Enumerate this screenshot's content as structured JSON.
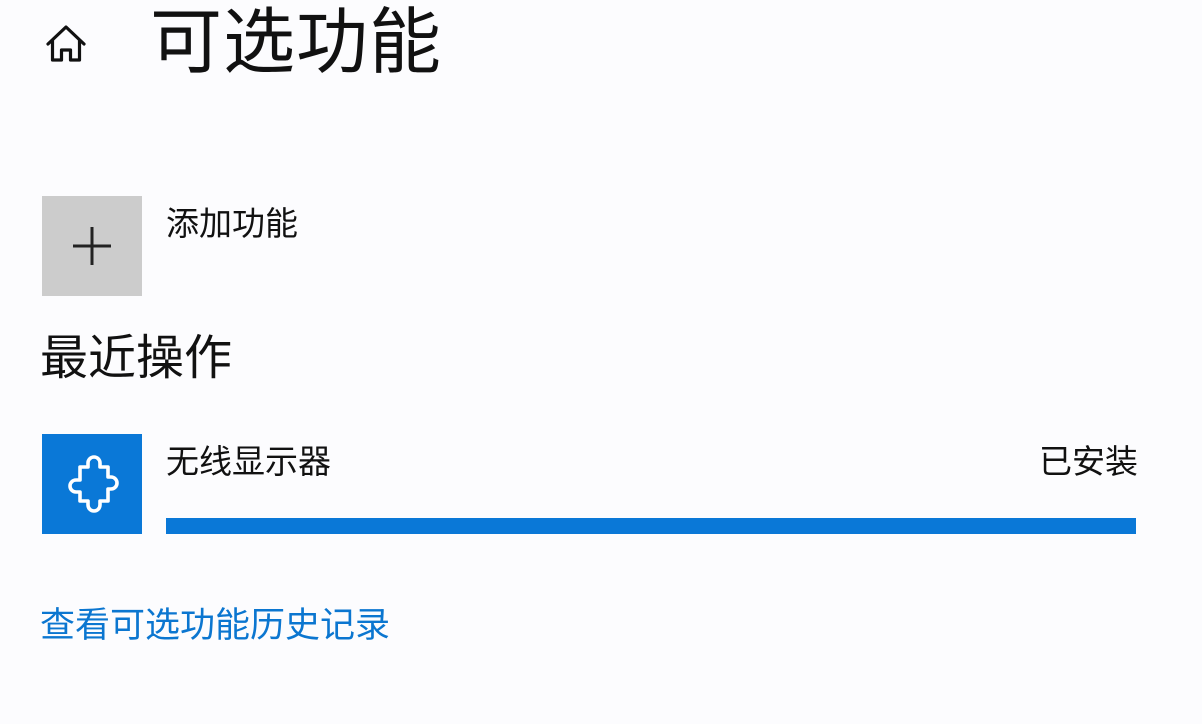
{
  "header": {
    "home_icon": "home-icon",
    "title": "可选功能"
  },
  "add_feature": {
    "icon": "plus-icon",
    "label": "添加功能"
  },
  "recent_actions": {
    "heading": "最近操作",
    "items": [
      {
        "icon": "puzzle-icon",
        "name": "无线显示器",
        "status": "已安装",
        "progress": 1.0
      }
    ]
  },
  "history_link": "查看可选功能历史记录",
  "colors": {
    "accent": "#0a78d7",
    "link": "#0b76d0",
    "tile_gray": "#cccccc",
    "background": "#fcfcfe"
  }
}
